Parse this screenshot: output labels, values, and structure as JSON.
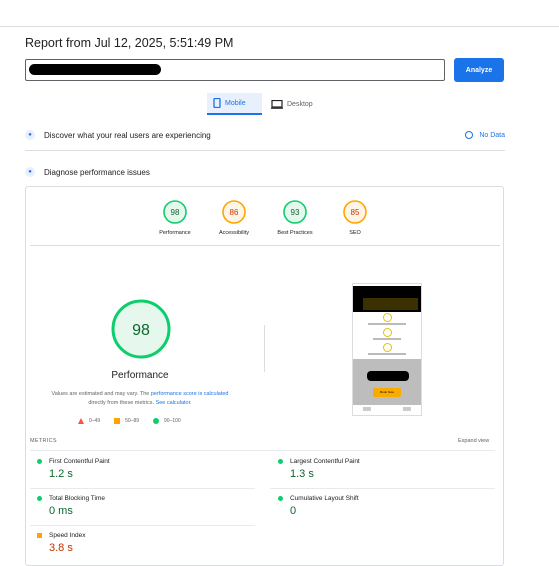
{
  "report": {
    "title": "Report from Jul 12, 2025, 5:51:49 PM"
  },
  "analyze": {
    "label": "Analyze"
  },
  "tabs": {
    "mobile": "Mobile",
    "desktop": "Desktop"
  },
  "sections": {
    "real_users": "Discover what your real users are experiencing",
    "no_data": "No Data",
    "diagnose": "Diagnose performance issues"
  },
  "scores": [
    {
      "label": "Performance",
      "value": "98",
      "color": "#0cce6b"
    },
    {
      "label": "Accessibility",
      "value": "86",
      "color": "#ffa400"
    },
    {
      "label": "Best Practices",
      "value": "93",
      "color": "#0cce6b"
    },
    {
      "label": "SEO",
      "value": "85",
      "color": "#ffa400"
    }
  ],
  "main": {
    "score": "98",
    "title": "Performance",
    "note1": "Values are estimated and may vary. The ",
    "note_link1": "performance score is calculated",
    "note2": " directly from these metrics. ",
    "note_link2": "See calculator."
  },
  "legend": {
    "fail": "0–49",
    "average": "50–89",
    "pass": "90–100"
  },
  "metrics_header": "METRICS",
  "expand_view": "Expand view",
  "metrics": [
    {
      "name": "First Contentful Paint",
      "value": "1.2 s",
      "status": "pass"
    },
    {
      "name": "Largest Contentful Paint",
      "value": "1.3 s",
      "status": "pass"
    },
    {
      "name": "Total Blocking Time",
      "value": "0 ms",
      "status": "pass"
    },
    {
      "name": "Cumulative Layout Shift",
      "value": "0",
      "status": "pass"
    },
    {
      "name": "Speed Index",
      "value": "3.8 s",
      "status": "average"
    }
  ],
  "screenshot": {
    "button_text": "Book Now"
  }
}
